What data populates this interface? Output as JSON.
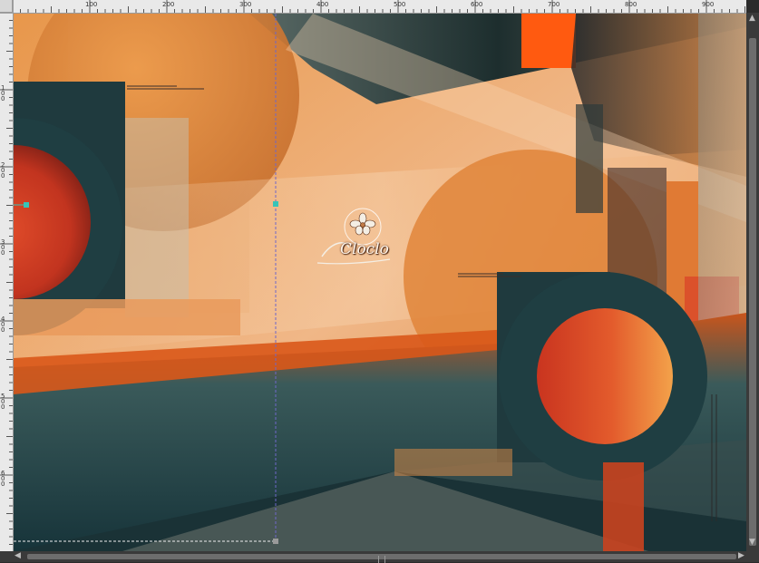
{
  "rulers": {
    "horizontal_labels": [
      "100",
      "200",
      "300",
      "400",
      "500",
      "600",
      "700",
      "800",
      "900"
    ],
    "vertical_labels": [
      "100",
      "200",
      "300",
      "400",
      "500",
      "600"
    ]
  },
  "watermark": {
    "text": "Cloclo"
  },
  "colors": {
    "orange": "#e9893a",
    "peach": "#e9b07c",
    "teal_dark": "#1f3e42",
    "red": "#c93a22",
    "bright_orange": "#ff5a10",
    "ruler_bg": "#e9e9e9",
    "scrollbar": "#3a3a3a",
    "guide_cyan": "#37c4b8"
  }
}
